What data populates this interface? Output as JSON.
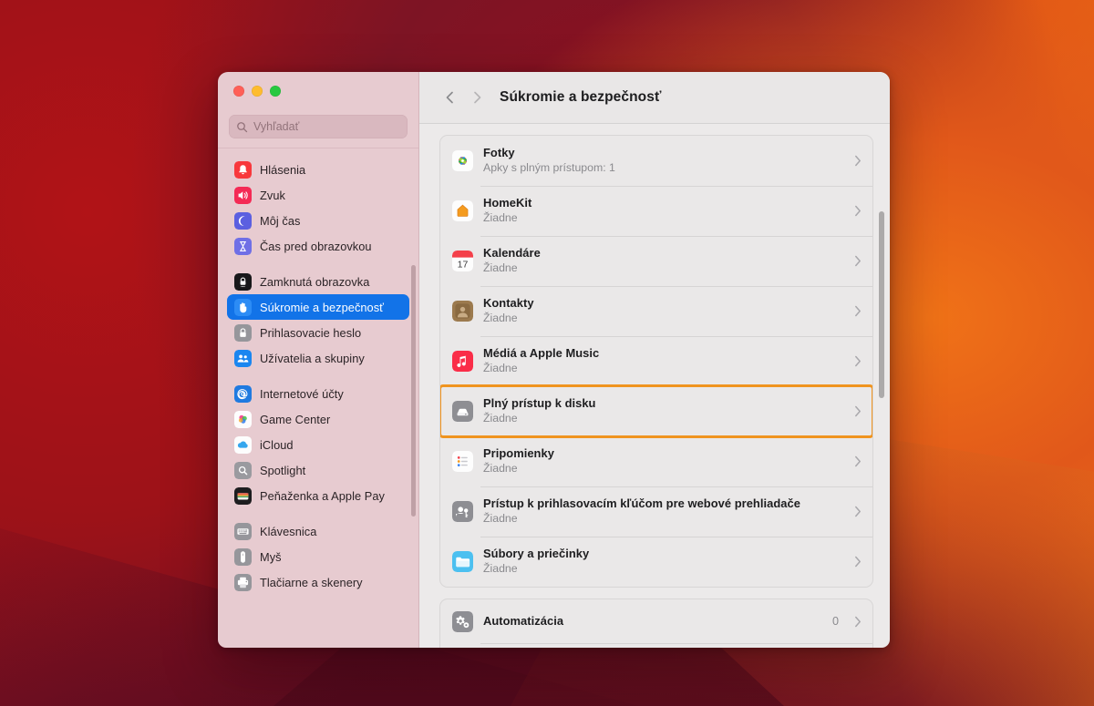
{
  "window": {
    "traffic_lights": [
      {
        "name": "close",
        "color": "#ff5f57"
      },
      {
        "name": "minimize",
        "color": "#febc2e"
      },
      {
        "name": "zoom",
        "color": "#28c840"
      }
    ]
  },
  "search": {
    "placeholder": "Vyhľadať",
    "value": "",
    "icon": "search-icon"
  },
  "sidebar": {
    "groups": [
      {
        "items": [
          {
            "label": "Hlásenia",
            "icon": "notifications-icon",
            "selected": false
          },
          {
            "label": "Zvuk",
            "icon": "sound-icon",
            "selected": false
          },
          {
            "label": "Môj čas",
            "icon": "focus-icon",
            "selected": false
          },
          {
            "label": "Čas pred obrazovkou",
            "icon": "screen-time-icon",
            "selected": false
          }
        ]
      },
      {
        "items": [
          {
            "label": "Zamknutá obrazovka",
            "icon": "lock-screen-icon",
            "selected": false
          },
          {
            "label": "Súkromie a bezpečnosť",
            "icon": "privacy-security-icon",
            "selected": true
          },
          {
            "label": "Prihlasovacie heslo",
            "icon": "login-password-icon",
            "selected": false
          },
          {
            "label": "Užívatelia a skupiny",
            "icon": "users-groups-icon",
            "selected": false
          }
        ]
      },
      {
        "items": [
          {
            "label": "Internetové účty",
            "icon": "internet-accounts-icon",
            "selected": false
          },
          {
            "label": "Game Center",
            "icon": "game-center-icon",
            "selected": false
          },
          {
            "label": "iCloud",
            "icon": "icloud-icon",
            "selected": false
          },
          {
            "label": "Spotlight",
            "icon": "spotlight-icon",
            "selected": false
          },
          {
            "label": "Peňaženka a Apple Pay",
            "icon": "wallet-icon",
            "selected": false
          }
        ]
      },
      {
        "items": [
          {
            "label": "Klávesnica",
            "icon": "keyboard-icon",
            "selected": false
          },
          {
            "label": "Myš",
            "icon": "mouse-icon",
            "selected": false
          },
          {
            "label": "Tlačiarne a skenery",
            "icon": "printers-scanners-icon",
            "selected": false
          }
        ]
      }
    ]
  },
  "header": {
    "back_icon": "chevron-left-icon",
    "forward_icon": "chevron-right-icon",
    "title": "Súkromie a bezpečnosť"
  },
  "main": {
    "cards": [
      {
        "rows": [
          {
            "title": "Fotky",
            "subtitle": "Apky s plným prístupom: 1",
            "value": "",
            "icon": "photos-icon",
            "highlighted": false
          },
          {
            "title": "HomeKit",
            "subtitle": "Žiadne",
            "value": "",
            "icon": "homekit-icon",
            "highlighted": false
          },
          {
            "title": "Kalendáre",
            "subtitle": "Žiadne",
            "value": "",
            "icon": "calendar-icon",
            "highlighted": false
          },
          {
            "title": "Kontakty",
            "subtitle": "Žiadne",
            "value": "",
            "icon": "contacts-icon",
            "highlighted": false
          },
          {
            "title": "Médiá a Apple Music",
            "subtitle": "Žiadne",
            "value": "",
            "icon": "music-icon",
            "highlighted": false
          },
          {
            "title": "Plný prístup k disku",
            "subtitle": "Žiadne",
            "value": "",
            "icon": "full-disk-access-icon",
            "highlighted": true
          },
          {
            "title": "Pripomienky",
            "subtitle": "Žiadne",
            "value": "",
            "icon": "reminders-icon",
            "highlighted": false
          },
          {
            "title": "Prístup k prihlasovacím kľúčom pre webové prehliadače",
            "subtitle": "Žiadne",
            "value": "",
            "icon": "passkeys-icon",
            "highlighted": false
          },
          {
            "title": "Súbory a priečinky",
            "subtitle": "Žiadne",
            "value": "",
            "icon": "files-folders-icon",
            "highlighted": false
          }
        ]
      },
      {
        "rows": [
          {
            "title": "Automatizácia",
            "subtitle": "",
            "value": "0",
            "icon": "automation-icon",
            "highlighted": false
          }
        ]
      }
    ],
    "calendar_day": "17"
  },
  "colors": {
    "accent": "#1273e8",
    "highlight": "#f0941f",
    "sidebar_bg": "#e7cbd0",
    "content_bg": "#eceaea"
  }
}
